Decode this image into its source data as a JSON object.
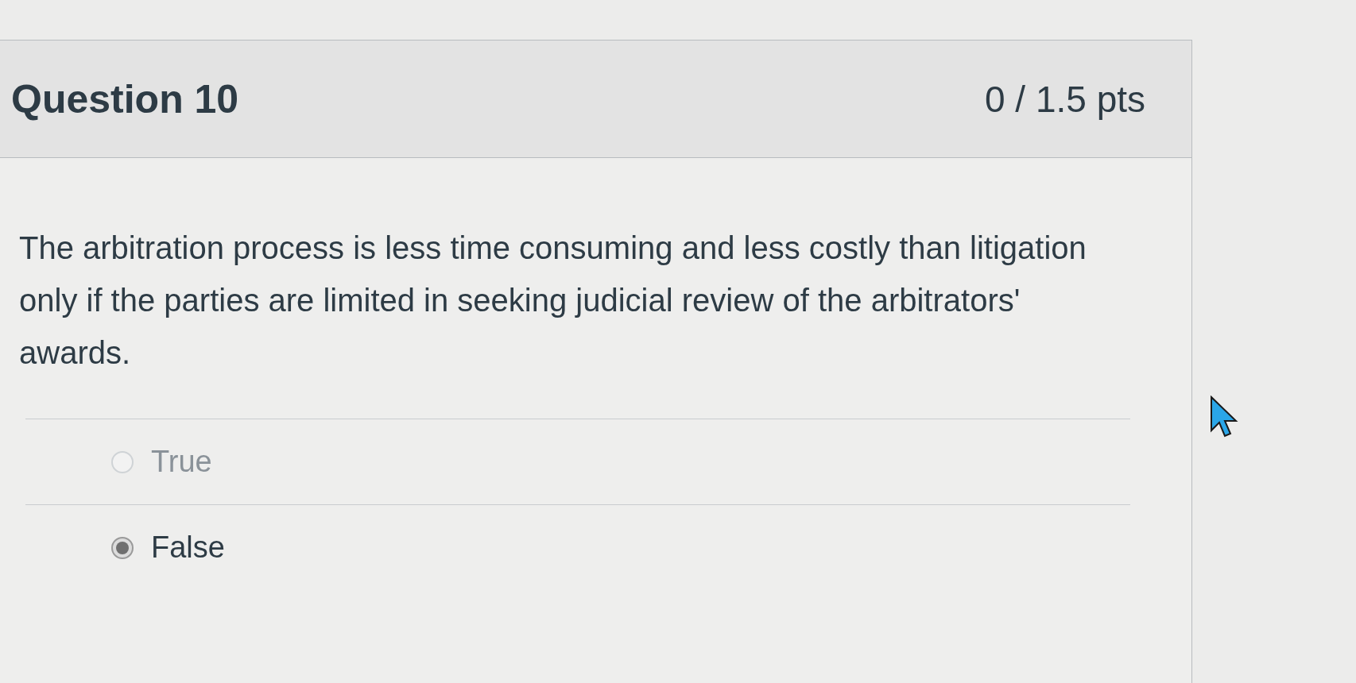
{
  "question": {
    "title": "Question 10",
    "points": "0 / 1.5 pts",
    "text": "The arbitration process is less time consuming and less costly than litigation only if the parties are limited in seeking judicial review of the arbitrators' awards.",
    "answers": [
      {
        "label": "True",
        "selected": false
      },
      {
        "label": "False",
        "selected": true
      }
    ]
  }
}
